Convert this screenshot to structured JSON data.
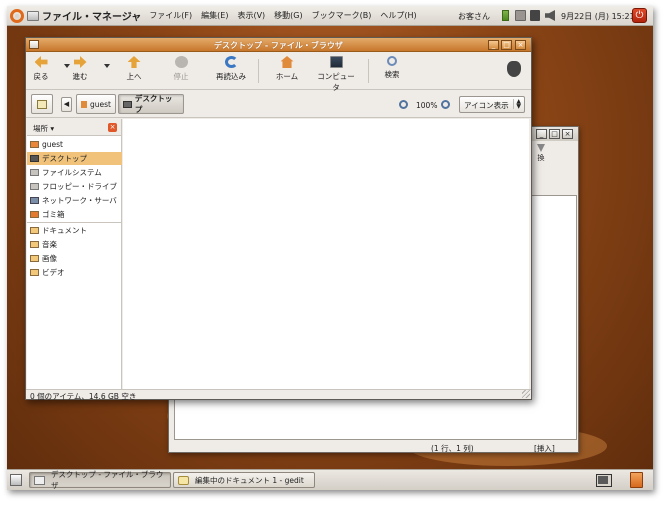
{
  "top_panel": {
    "app_title": "ファイル・マネージャ",
    "menus": [
      "ファイル(F)",
      "編集(E)",
      "表示(V)",
      "移動(G)",
      "ブックマーク(B)",
      "ヘルプ(H)"
    ],
    "user": "お客さん",
    "clock": "9月22日 (月) 15:21"
  },
  "browser": {
    "title": "デスクトップ - ファイル・ブラウザ",
    "toolbar": {
      "back": "戻る",
      "forward": "進む",
      "up": "上へ",
      "stop": "停止",
      "reload": "再読込み",
      "home": "ホーム",
      "computer": "コンピュータ",
      "search": "検索"
    },
    "location": {
      "home_crumb": "guest",
      "desktop_crumb": "デスクトップ",
      "zoom_level": "100%",
      "view_mode": "アイコン表示"
    },
    "sidebar": {
      "header": "場所 ▾",
      "items": [
        {
          "label": "guest",
          "icon": "home-folder-icon"
        },
        {
          "label": "デスクトップ",
          "icon": "desktop-icon",
          "selected": true
        },
        {
          "label": "ファイルシステム",
          "icon": "filesystem-icon"
        },
        {
          "label": "フロッピー・ドライブ",
          "icon": "floppy-icon"
        },
        {
          "label": "ネットワーク・サーバ",
          "icon": "network-icon"
        },
        {
          "label": "ゴミ箱",
          "icon": "trash-icon"
        }
      ],
      "bookmarks": [
        {
          "label": "ドキュメント",
          "icon": "folder-icon"
        },
        {
          "label": "音楽",
          "icon": "folder-icon"
        },
        {
          "label": "画像",
          "icon": "folder-icon"
        },
        {
          "label": "ビデオ",
          "icon": "folder-icon"
        }
      ]
    },
    "status": "0 個のアイテム、14.6 GB 空き"
  },
  "gedit": {
    "replace_label": "換",
    "cursor_position": "(1 行、1 列)",
    "insert_mode": "[挿入]"
  },
  "bottom_panel": {
    "task_browser": "デスクトップ - ファイル・ブラウザ",
    "task_gedit": "編集中のドキュメント 1 - gedit"
  },
  "colors": {
    "accent_orange": "#c8772c",
    "selection": "#f0c27a",
    "desktop_brown": "#8b4516"
  }
}
